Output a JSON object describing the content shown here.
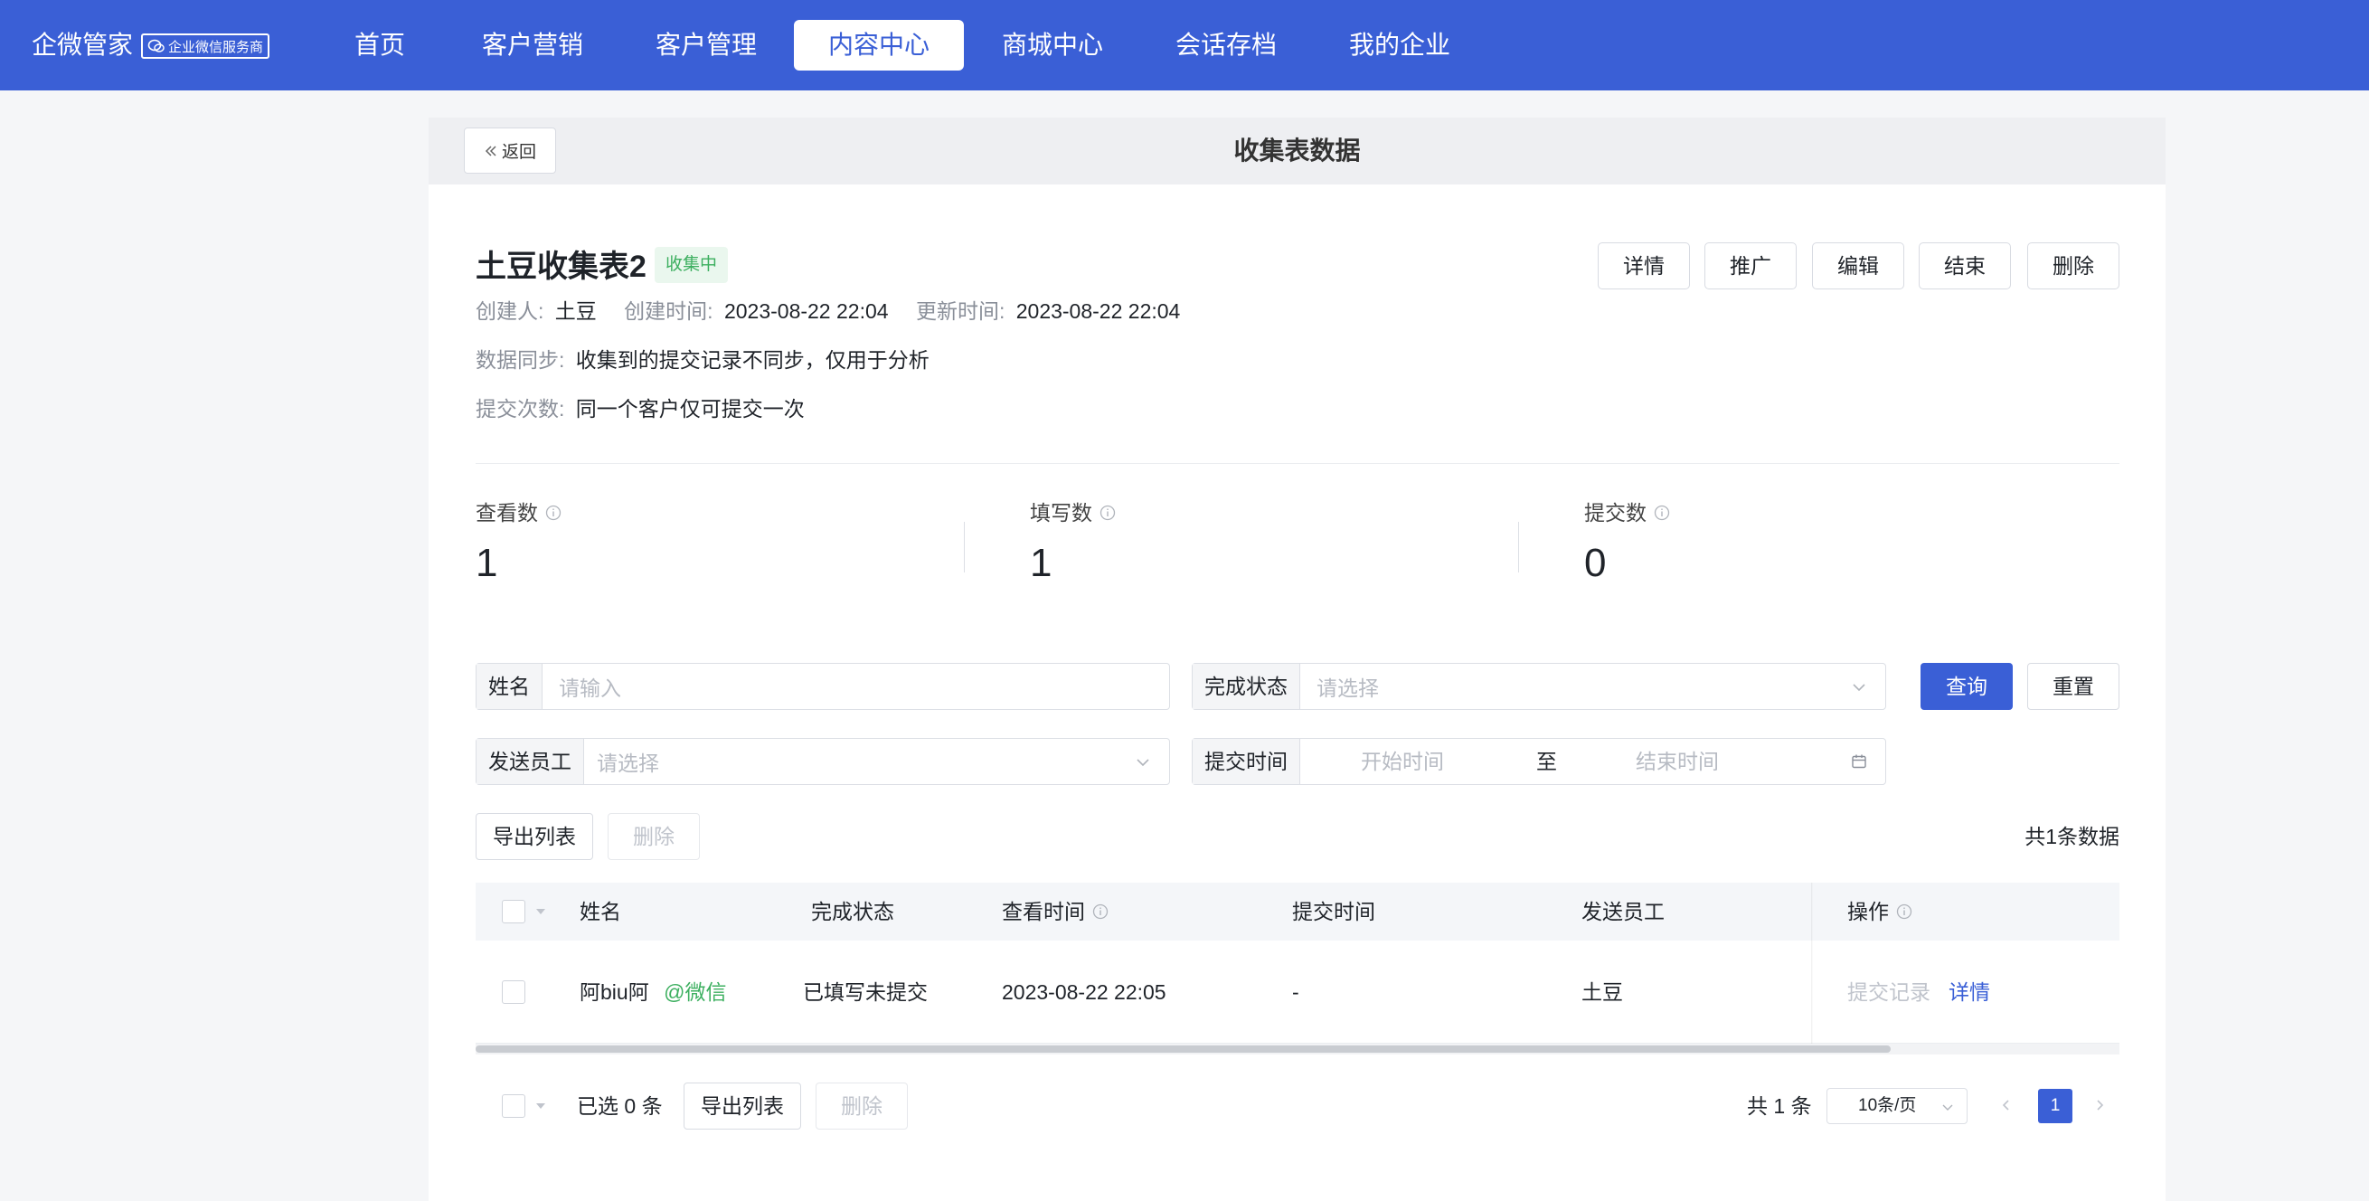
{
  "topbar": {
    "brand": "企微管家",
    "badge": "企业微信服务商",
    "nav": [
      "首页",
      "客户营销",
      "客户管理",
      "内容中心",
      "商城中心",
      "会话存档",
      "我的企业"
    ],
    "active_nav": "内容中心"
  },
  "header": {
    "back_label": "返回",
    "title": "收集表数据"
  },
  "form": {
    "name": "土豆收集表2",
    "status": "收集中",
    "actions": [
      "详情",
      "推广",
      "编辑",
      "结束",
      "删除"
    ],
    "creator_label": "创建人:",
    "creator": "土豆",
    "created_label": "创建时间:",
    "created": "2023-08-22 22:04",
    "updated_label": "更新时间:",
    "updated": "2023-08-22 22:04",
    "sync_label": "数据同步:",
    "sync": "收集到的提交记录不同步，仅用于分析",
    "submit_label": "提交次数:",
    "submit": "同一个客户仅可提交一次"
  },
  "stats": [
    {
      "label": "查看数",
      "value": "1"
    },
    {
      "label": "填写数",
      "value": "1"
    },
    {
      "label": "提交数",
      "value": "0"
    }
  ],
  "filters": {
    "name_label": "姓名",
    "name_placeholder": "请输入",
    "status_label": "完成状态",
    "status_placeholder": "请选择",
    "staff_label": "发送员工",
    "staff_placeholder": "请选择",
    "time_label": "提交时间",
    "start_placeholder": "开始时间",
    "to": "至",
    "end_placeholder": "结束时间",
    "query": "查询",
    "reset": "重置"
  },
  "toolbar": {
    "export": "导出列表",
    "delete": "删除",
    "total": "共1条数据"
  },
  "table": {
    "columns": [
      "姓名",
      "完成状态",
      "查看时间",
      "提交时间",
      "发送员工",
      "操作"
    ],
    "rows": [
      {
        "name": "阿biu阿",
        "source": "@微信",
        "status": "已填写未提交",
        "view_time": "2023-08-22 22:05",
        "submit_time": "-",
        "staff": "土豆",
        "op_records": "提交记录",
        "op_detail": "详情"
      }
    ]
  },
  "footer": {
    "selected": "已选 0 条",
    "export": "导出列表",
    "delete": "删除",
    "total": "共 1 条",
    "page_size": "10条/页",
    "current_page": "1"
  },
  "colors": {
    "primary": "#3a5fd6",
    "success": "#3caf5f"
  }
}
